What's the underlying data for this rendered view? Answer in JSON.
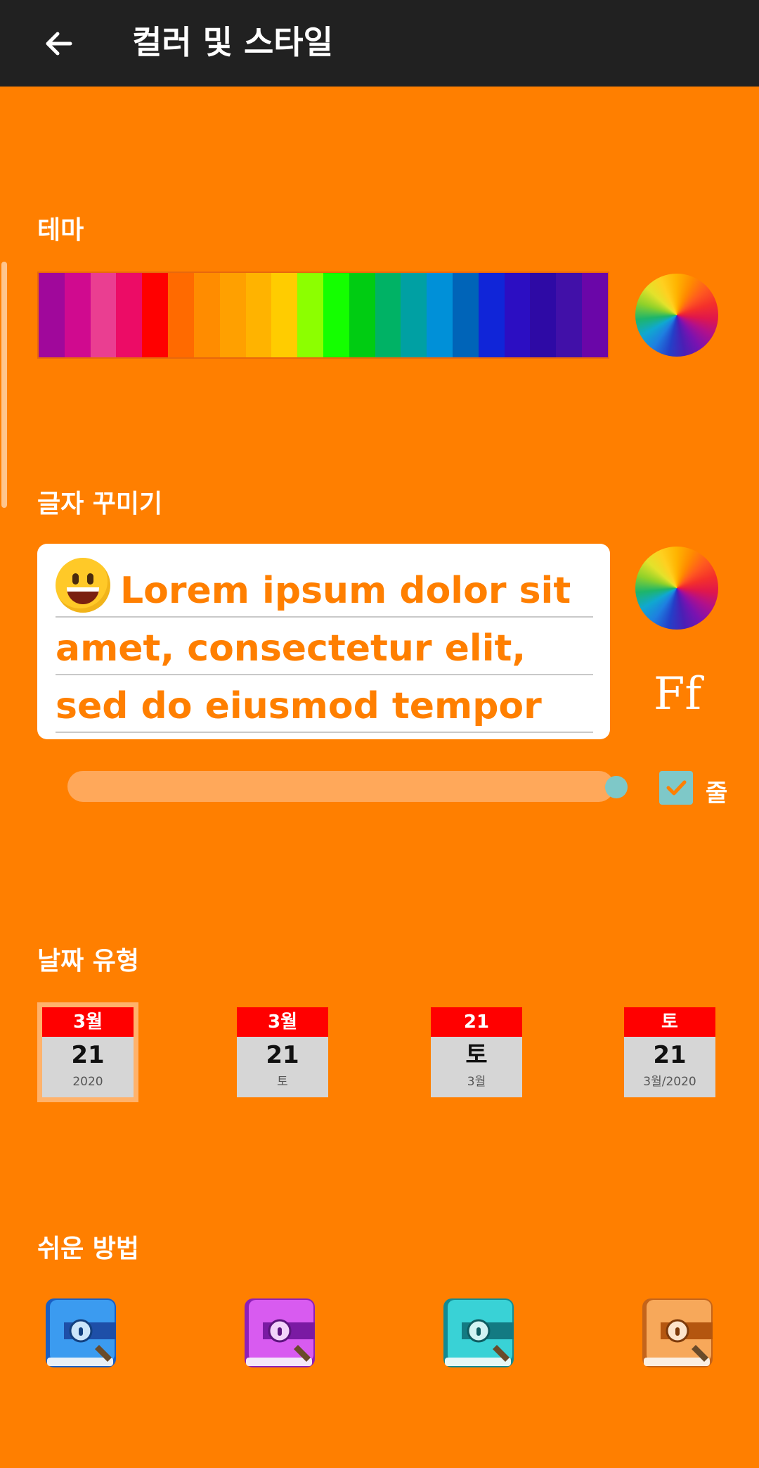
{
  "appbar": {
    "title": "컬러 및 스타일",
    "back_icon": "arrow-left-icon"
  },
  "colors": {
    "background": "#FF7F00",
    "appbar": "#212121",
    "accent": "#7EC8C8"
  },
  "theme": {
    "title": "테마",
    "swatches": [
      "#A0089B",
      "#D00A8F",
      "#EA3E91",
      "#EC0C66",
      "#FF0000",
      "#FF6A00",
      "#FF8C00",
      "#FFA000",
      "#FFB300",
      "#FFCC00",
      "#8CFF00",
      "#14FF00",
      "#00CC12",
      "#00B265",
      "#00A0A3",
      "#0090D8",
      "#0064B8",
      "#1025D8",
      "#2C0EC2",
      "#2E0AA5",
      "#4110A8",
      "#6A06A8"
    ],
    "picker_icon": "color-wheel-icon"
  },
  "text_style": {
    "title": "글자 꾸미기",
    "preview_emoji": "grinning-face-icon",
    "preview_text": "Lorem ipsum dolor sit amet, consectetur elit, sed do eiusmod tempor",
    "color_picker_icon": "color-wheel-icon",
    "font_button_label": "Ff",
    "slider_value": 1.0,
    "checkbox_checked": true,
    "checkbox_label": "줄"
  },
  "date_format": {
    "title": "날짜 유형",
    "options": [
      {
        "top": "3월",
        "mid": "21",
        "bot": "2020",
        "selected": true
      },
      {
        "top": "3월",
        "mid": "21",
        "bot": "토",
        "selected": false
      },
      {
        "top": "21",
        "mid": "토",
        "bot": "3월",
        "selected": false
      },
      {
        "top": "토",
        "mid": "21",
        "bot": "3월/2020",
        "selected": false
      }
    ]
  },
  "easy_method": {
    "title": "쉬운 방법",
    "books": [
      {
        "icon": "blue-diary-icon",
        "color": "#2E8BE8"
      },
      {
        "icon": "purple-diary-icon",
        "color": "#C54BE3"
      },
      {
        "icon": "teal-diary-icon",
        "color": "#2DC7C9"
      },
      {
        "icon": "orange-diary-icon",
        "color": "#F39A3A"
      }
    ]
  }
}
